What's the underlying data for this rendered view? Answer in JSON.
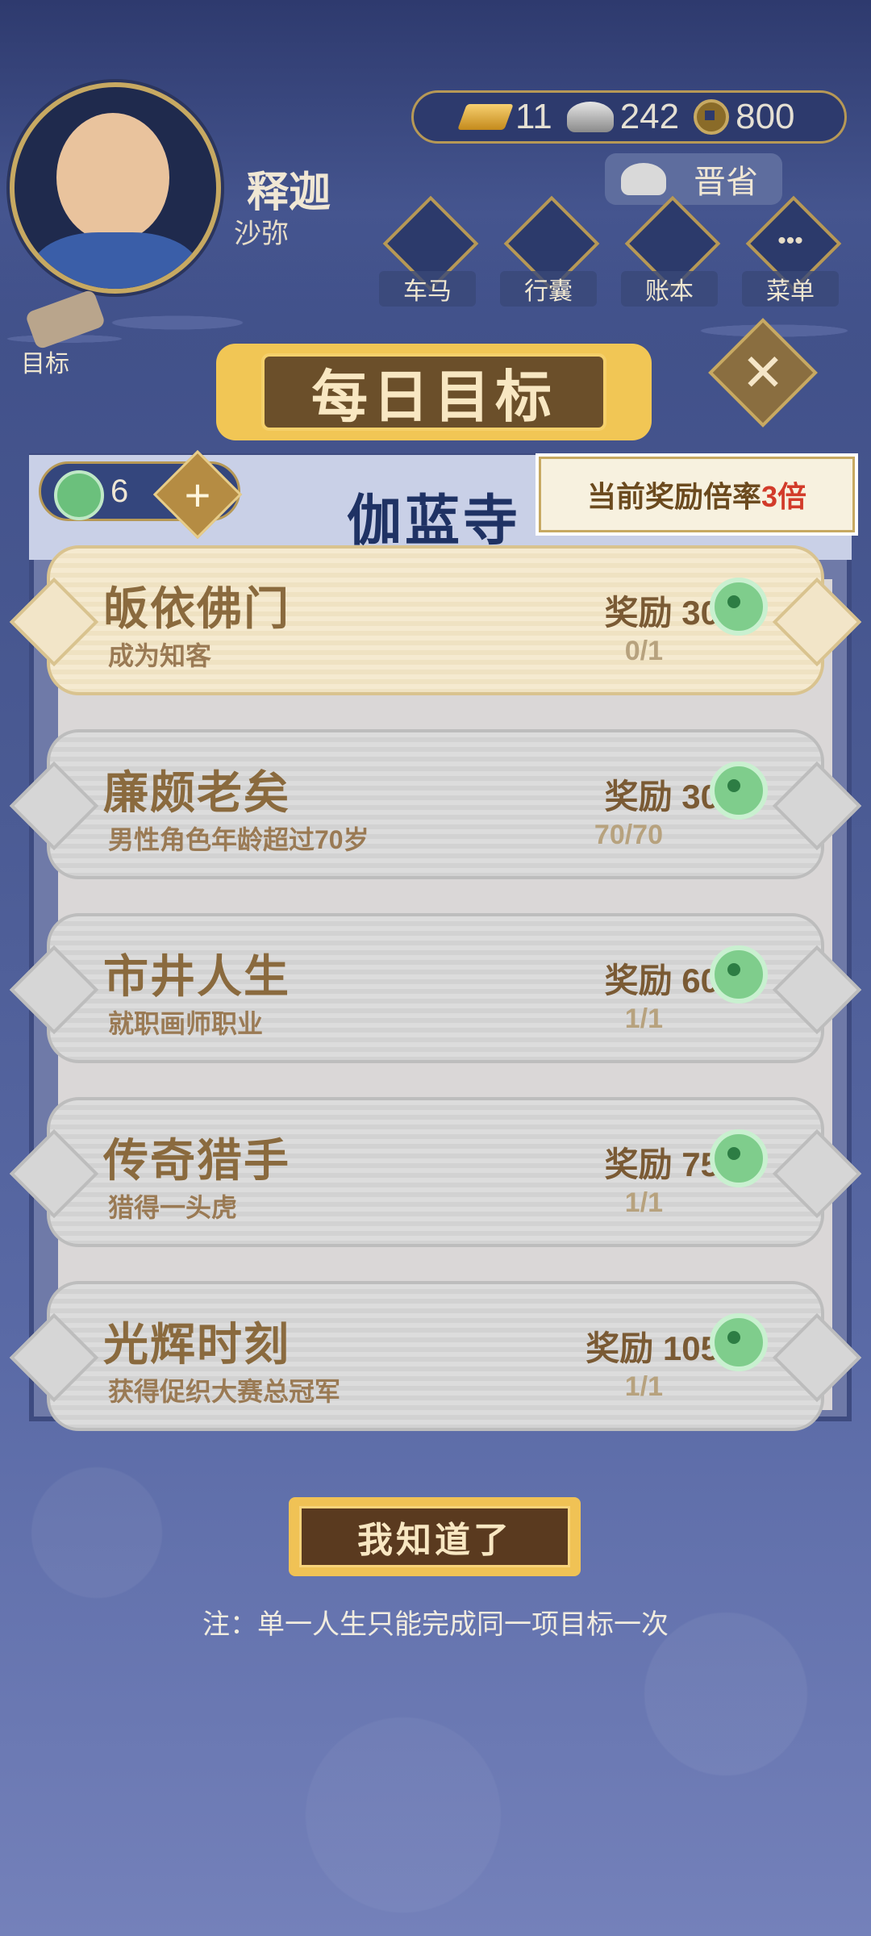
{
  "hud": {
    "name": "释迦",
    "rank": "沙弥",
    "gold": "11",
    "silver": "242",
    "coins": "800",
    "jinsheng_label": "晋省",
    "menu": [
      {
        "label": "车马",
        "icon": "carriage-icon"
      },
      {
        "label": "行囊",
        "icon": "bag-icon"
      },
      {
        "label": "账本",
        "icon": "ledger-icon"
      },
      {
        "label": "菜单",
        "icon": "more-icon"
      }
    ],
    "goal_label": "目标"
  },
  "dialog": {
    "title": "每日目标",
    "jade_count": "6",
    "plus": "+",
    "temple": "伽蓝寺",
    "multiplier_prefix": "当前奖励倍率",
    "multiplier_value": "3倍",
    "close": "✕"
  },
  "goals": [
    {
      "title": "皈依佛门",
      "desc": "成为知客",
      "reward": "奖励 30",
      "progress": "0/1"
    },
    {
      "title": "廉颇老矣",
      "desc": "男性角色年龄超过70岁",
      "reward": "奖励 30",
      "progress": "70/70"
    },
    {
      "title": "市井人生",
      "desc": "就职画师职业",
      "reward": "奖励 60",
      "progress": "1/1"
    },
    {
      "title": "传奇猎手",
      "desc": "猎得一头虎",
      "reward": "奖励 75",
      "progress": "1/1"
    },
    {
      "title": "光辉时刻",
      "desc": "获得促织大赛总冠军",
      "reward": "奖励 105",
      "progress": "1/1"
    }
  ],
  "footer": {
    "ok_label": "我知道了",
    "note": "注：单一人生只能完成同一项目标一次"
  }
}
